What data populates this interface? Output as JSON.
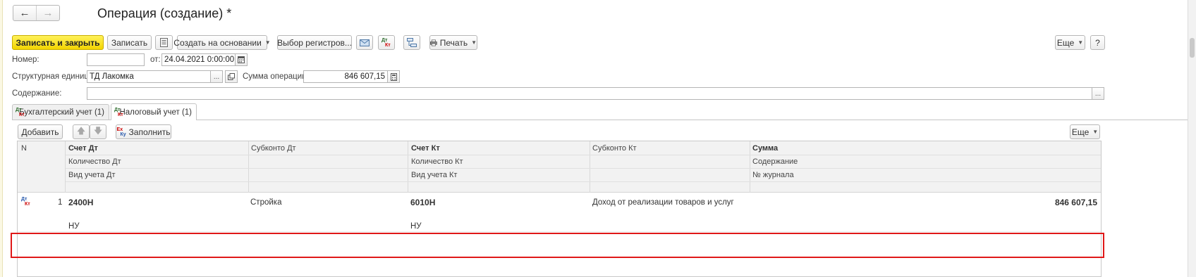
{
  "window": {
    "title": "Операция (создание) *",
    "nav_back": "←",
    "nav_forward": "→"
  },
  "toolbar": {
    "save_close": "Записать и закрыть",
    "save": "Записать",
    "create_based": "Создать на основании",
    "register_select": "Выбор регистров...",
    "print": "Печать",
    "more": "Еще",
    "help": "?"
  },
  "form": {
    "number_label": "Номер:",
    "number_value": "",
    "date_label": "от:",
    "date_value": "24.04.2021  0:00:00",
    "unit_label": "Структурная единица:",
    "unit_value": "ТД Лакомка",
    "sum_label": "Сумма операции:",
    "sum_value": "846 607,15",
    "content_label": "Содержание:",
    "content_value": "",
    "ellipsis": "..."
  },
  "tabs": [
    {
      "label": "Бухгалтерский учет (1)",
      "active": false
    },
    {
      "label": "Налоговый учет (1)",
      "active": true
    }
  ],
  "table_toolbar": {
    "add": "Добавить",
    "fill": "Заполнить",
    "more": "Еще",
    "up": "🡅",
    "down": "🡇"
  },
  "table": {
    "headers": {
      "n": "N",
      "account_dt": "Счет Дт",
      "qty_dt": "Количество Дт",
      "type_dt": "Вид учета Дт",
      "subconto_dt": "Субконто Дт",
      "account_kt": "Счет Кт",
      "qty_kt": "Количество Кт",
      "type_kt": "Вид учета Кт",
      "subconto_kt": "Субконто Кт",
      "sum": "Сумма",
      "content": "Содержание",
      "journal": "№ журнала"
    },
    "rows": [
      {
        "n": "1",
        "account_dt": "2400Н",
        "type_dt": "НУ",
        "subconto_dt": "Стройка",
        "account_kt": "6010Н",
        "type_kt": "НУ",
        "subconto_kt": "Доход от реализации товаров и услуг",
        "sum": "846 607,15"
      }
    ]
  },
  "icons": {
    "dt_kt": {
      "dt": "Дт",
      "kt": "Кт"
    },
    "fill_icon": {
      "top": "Ех",
      "bottom": "Ку"
    }
  },
  "colors": {
    "primary_button": "#f3d400",
    "highlight_border": "#e01818"
  }
}
